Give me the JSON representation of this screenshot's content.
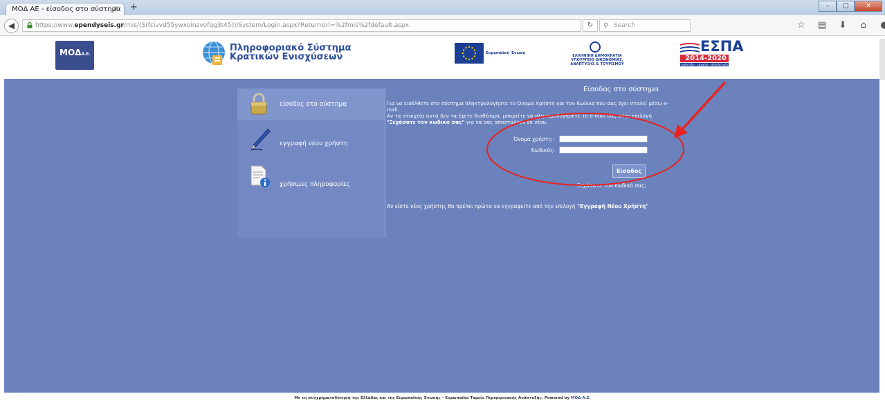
{
  "browser": {
    "tab_title": "ΜΟΔ ΑΕ - είσοδος στο σύστημα",
    "tab_close": "×",
    "new_tab": "+",
    "url_prefix": "https://www.",
    "url_host": "ependyseis.gr",
    "url_path": "/mis/(S(fcivvd55ywxoinzvofqg3t45))/System/Login.aspx?ReturnUrl=%2fmis%2fdefault.aspx",
    "search_placeholder": "Search"
  },
  "header": {
    "moa_logo": "ΜΟΔ",
    "moa_suffix": "Α.Ε.",
    "pss_line1": "Πληροφοριακό Σύστημα",
    "pss_line2": "Κρατικών Ενισχύσεων",
    "eu_text": "Ευρωπαϊκή Ένωση",
    "gr_text_1": "ΕΛΛΗΝΙΚΗ ΔΗΜΟΚΡΑΤΙΑ",
    "gr_text_2": "ΥΠΟΥΡΓΕΙΟ ΟΙΚΟΝΟΜΙΑΣ,",
    "gr_text_3": "ΑΝΑΠΤΥΞΗΣ & ΤΟΥΡΙΣΜΟΥ",
    "espa_title": "ΕΣΠΑ",
    "espa_years": "2014-2020",
    "espa_tagline": "ανάπτυξη - εργασία - αλληλεγγύη"
  },
  "menu": {
    "items": [
      {
        "label": "είσοδος στο σύστημα"
      },
      {
        "label": "εγγραφή νέου χρήστη"
      },
      {
        "label": "χρήσιμες πληροφορίες"
      }
    ]
  },
  "login": {
    "title": "Είσοδος στο σύστημα",
    "intro_1": "Για να εισέλθετε στο σύστημα πληκτρολογήστε το Όνομα Χρήστη και τον Κωδικό που σας έχει σταλεί μέσω e-mail.",
    "intro_2a": "Αν τα στοιχεία αυτά δεν τα έχετε διαθέσιμα, μπορείτε να πληκτρολογήσετε το e-mail σας στην επιλογή ",
    "intro_2b": "\"Ξεχάσατε τον κωδικό σας\"",
    "intro_2c": " για να σας αποσταλούν εκ νέου.",
    "username_label": "Όνομα χρήστη :",
    "password_label": "Κωδικός:",
    "username_value": "",
    "password_value": "",
    "submit_label": "Είσοδος",
    "forgot_link": "Ξεχάσατε τον κωδικό σας;",
    "new_user_a": "Αν είστε νέος χρήστης θα πρέπει πρώτα να εγγραφείτε από την επιλογή ",
    "new_user_b": "\"Εγγραφή Νέου Χρήστη\""
  },
  "footer": {
    "text": "Με τη συγχρηματοδότηση της Ελλάδας και της Ευρωπαϊκής Ένωσης – Ευρωπαϊκό Ταμείο Περιφερειακής Ανάπτυξης. Powered by ",
    "brand": "ΜΟΔ Α.Ε."
  },
  "colors": {
    "main_bg": "#6b82bc",
    "annotation": "#e8231f"
  }
}
